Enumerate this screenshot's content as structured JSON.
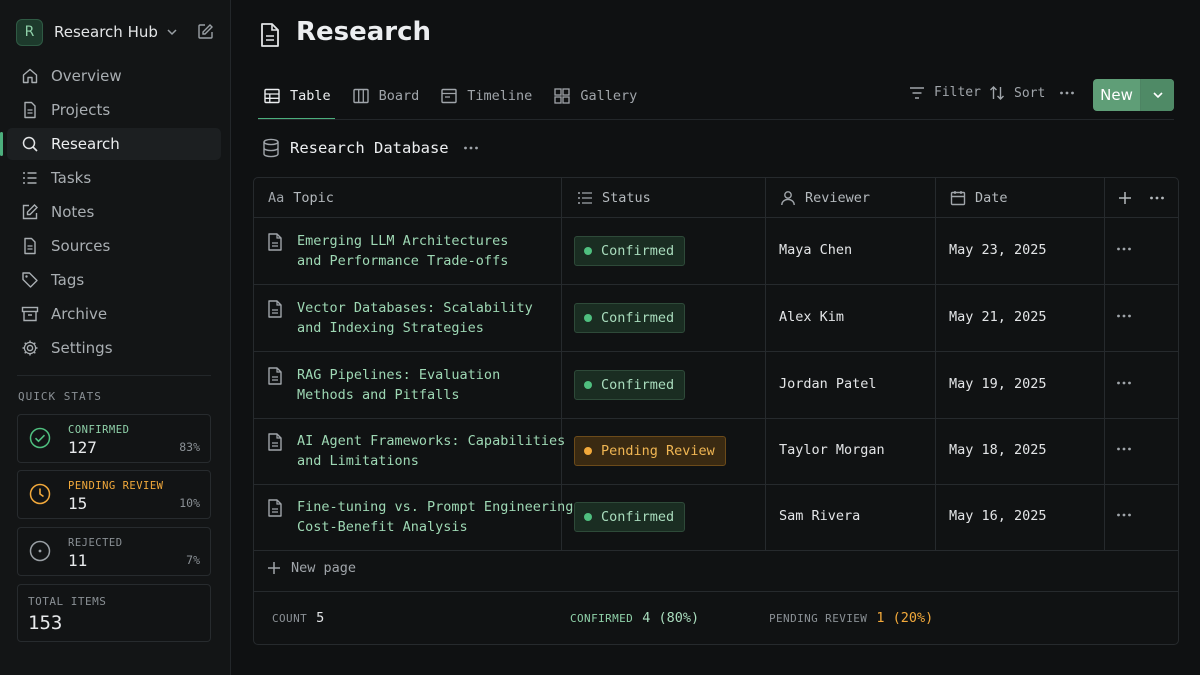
{
  "workspace": {
    "avatar": "R",
    "name": "Research Hub"
  },
  "sidebar": {
    "items": [
      {
        "label": "Overview",
        "icon": "home-icon"
      },
      {
        "label": "Projects",
        "icon": "document-icon"
      },
      {
        "label": "Research",
        "icon": "search-icon",
        "active": true
      },
      {
        "label": "Tasks",
        "icon": "list-icon"
      },
      {
        "label": "Notes",
        "icon": "edit-icon"
      },
      {
        "label": "Sources",
        "icon": "document-icon"
      },
      {
        "label": "Tags",
        "icon": "tag-icon"
      },
      {
        "label": "Archive",
        "icon": "archive-icon"
      },
      {
        "label": "Settings",
        "icon": "gear-icon"
      }
    ]
  },
  "quick_stats": {
    "title": "QUICK STATS",
    "confirmed": {
      "label": "CONFIRMED",
      "value": "127",
      "percent": "83%",
      "color": "#4fbf7f"
    },
    "pending": {
      "label": "PENDING REVIEW",
      "value": "15",
      "percent": "10%",
      "color": "#f2a93b"
    },
    "rejected": {
      "label": "REJECTED",
      "value": "11",
      "percent": "7%",
      "color": "#9aa0a5"
    },
    "total": {
      "label": "TOTAL ITEMS",
      "value": "153"
    }
  },
  "page": {
    "title": "Research"
  },
  "tabs": [
    {
      "label": "Table",
      "icon": "table-icon",
      "active": true
    },
    {
      "label": "Board",
      "icon": "board-icon"
    },
    {
      "label": "Timeline",
      "icon": "timeline-icon"
    },
    {
      "label": "Gallery",
      "icon": "gallery-icon"
    }
  ],
  "toolbar": {
    "filter": "Filter",
    "sort": "Sort",
    "new": "New"
  },
  "database": {
    "title": "Research Database"
  },
  "table": {
    "columns": {
      "topic": "Topic",
      "topic_prefix": "Aa",
      "status": "Status",
      "reviewer": "Reviewer",
      "date": "Date"
    },
    "rows": [
      {
        "topic": "Emerging LLM Architectures\nand Performance Trade-offs",
        "status": "Confirmed",
        "status_kind": "ok",
        "reviewer": "Maya Chen",
        "date": "May 23, 2025"
      },
      {
        "topic": "Vector Databases: Scalability\nand Indexing Strategies",
        "status": "Confirmed",
        "status_kind": "ok",
        "reviewer": "Alex Kim",
        "date": "May 21, 2025"
      },
      {
        "topic": "RAG Pipelines: Evaluation\nMethods and Pitfalls",
        "status": "Confirmed",
        "status_kind": "ok",
        "reviewer": "Jordan Patel",
        "date": "May 19, 2025"
      },
      {
        "topic": "AI Agent Frameworks: Capabilities\nand Limitations",
        "status": "Pending Review",
        "status_kind": "pend",
        "reviewer": "Taylor Morgan",
        "date": "May 18, 2025"
      },
      {
        "topic": "Fine-tuning vs. Prompt Engineering:\nCost-Benefit Analysis",
        "status": "Confirmed",
        "status_kind": "ok",
        "reviewer": "Sam Rivera",
        "date": "May 16, 2025"
      }
    ],
    "new_page": "New page",
    "footer": {
      "count_label": "COUNT",
      "count_value": "5",
      "confirmed_label": "CONFIRMED",
      "confirmed_value": "4 (80%)",
      "pending_label": "PENDING REVIEW",
      "pending_value": "1 (20%)"
    }
  },
  "colors": {
    "accent": "#4caf7d",
    "confirmed": "#4fbf7f",
    "pending": "#f2a93b",
    "topic_text": "#9ed8b4"
  }
}
